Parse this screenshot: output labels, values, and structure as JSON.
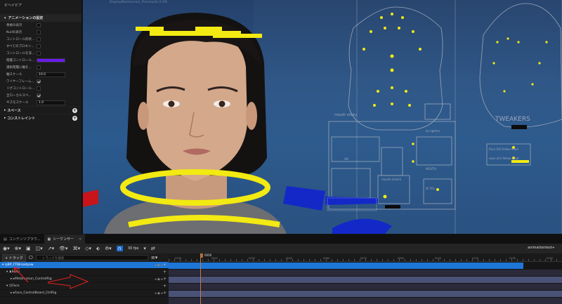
{
  "details": {
    "top_tab": "ビヘイビア",
    "section_title": "アニメーションの設定",
    "properties": [
      {
        "label": "骨格の表示",
        "type": "checkbox",
        "checked": false
      },
      {
        "label": "Nullの表示",
        "type": "checkbox",
        "checked": false
      },
      {
        "label": "コントロール形状...",
        "type": "checkbox",
        "checked": false
      },
      {
        "label": "すべてのプロキシ...",
        "type": "checkbox",
        "checked": false
      },
      {
        "label": "コントロールを非...",
        "type": "checkbox",
        "checked": false
      },
      {
        "label": "階層コントロール...",
        "type": "color",
        "color": "#6a1cf0"
      },
      {
        "label": "選択階層に軸を...",
        "type": "checkbox",
        "checked": false
      },
      {
        "label": "軸スケール",
        "type": "number",
        "value": "10.0"
      },
      {
        "label": "ワイヤーフレーム...",
        "type": "checkbox",
        "checked": true
      },
      {
        "label": "リグコントロール...",
        "type": "checkbox",
        "checked": false
      },
      {
        "label": "全ローカルスペ...",
        "type": "checkbox",
        "checked": true
      },
      {
        "label": "ギズモスケール",
        "type": "number",
        "value": "1.0"
      }
    ],
    "categories": [
      "スペース",
      "コンストレイント"
    ]
  },
  "viewport": {
    "title": "DisplayMetahuman_Preview/(k 0.00)",
    "panel_labels": {
      "mouth_stickyness": "mouth sticky",
      "tweakers": "TWEAKERS",
      "tongue": "tongue",
      "jaw": "JAW",
      "head_follow": "Face GUI follow head",
      "eyes_follow": "eyes aim follow head",
      "mouth": "MOUTH",
      "lip_tighten": "lip tighten",
      "w_tgl": "W TGL",
      "oh": "OH",
      "mouth_stretch": "mouth stretch",
      "lip_bite": "lip bite",
      "lips_blow": "lips blow",
      "lips_purse": "lips purse",
      "lip_towards": "lip towards",
      "mouth_funnel": "mouth funnel"
    }
  },
  "tabs": [
    {
      "label": "コンテンツブラウ...",
      "active": false
    },
    {
      "label": "シーケンサー",
      "active": true
    }
  ],
  "toolbar": {
    "fps": "30 fps",
    "sequence_name": "animationtest+"
  },
  "tracks_header": {
    "add_track": "+ トラック",
    "search_placeholder": "トラックを検索"
  },
  "ruler": {
    "playhead": "0000",
    "labels": [
      "-0150",
      "0015",
      "0030",
      "0045",
      "0060",
      "0075",
      "0090",
      "0105",
      "0120",
      "0135",
      "0150"
    ]
  },
  "tree": [
    {
      "label": "BP_FTIBroadyaw",
      "level": 0,
      "selected": true
    },
    {
      "label": "Body",
      "level": 1,
      "selected": false
    },
    {
      "label": "Metahuman_ControlRig",
      "level": 2,
      "selected": false
    },
    {
      "label": "Face",
      "level": 1,
      "selected": false
    },
    {
      "label": "Face_ControlBoard_CtrlRig",
      "level": 2,
      "selected": false
    }
  ],
  "colors": {
    "accent": "#1e76d6",
    "rig_yellow": "#f2ea12",
    "rig_blue": "#1428c8",
    "rig_red": "#c8141a",
    "track_body": "#4a5277",
    "track_face": "#4a5277"
  }
}
